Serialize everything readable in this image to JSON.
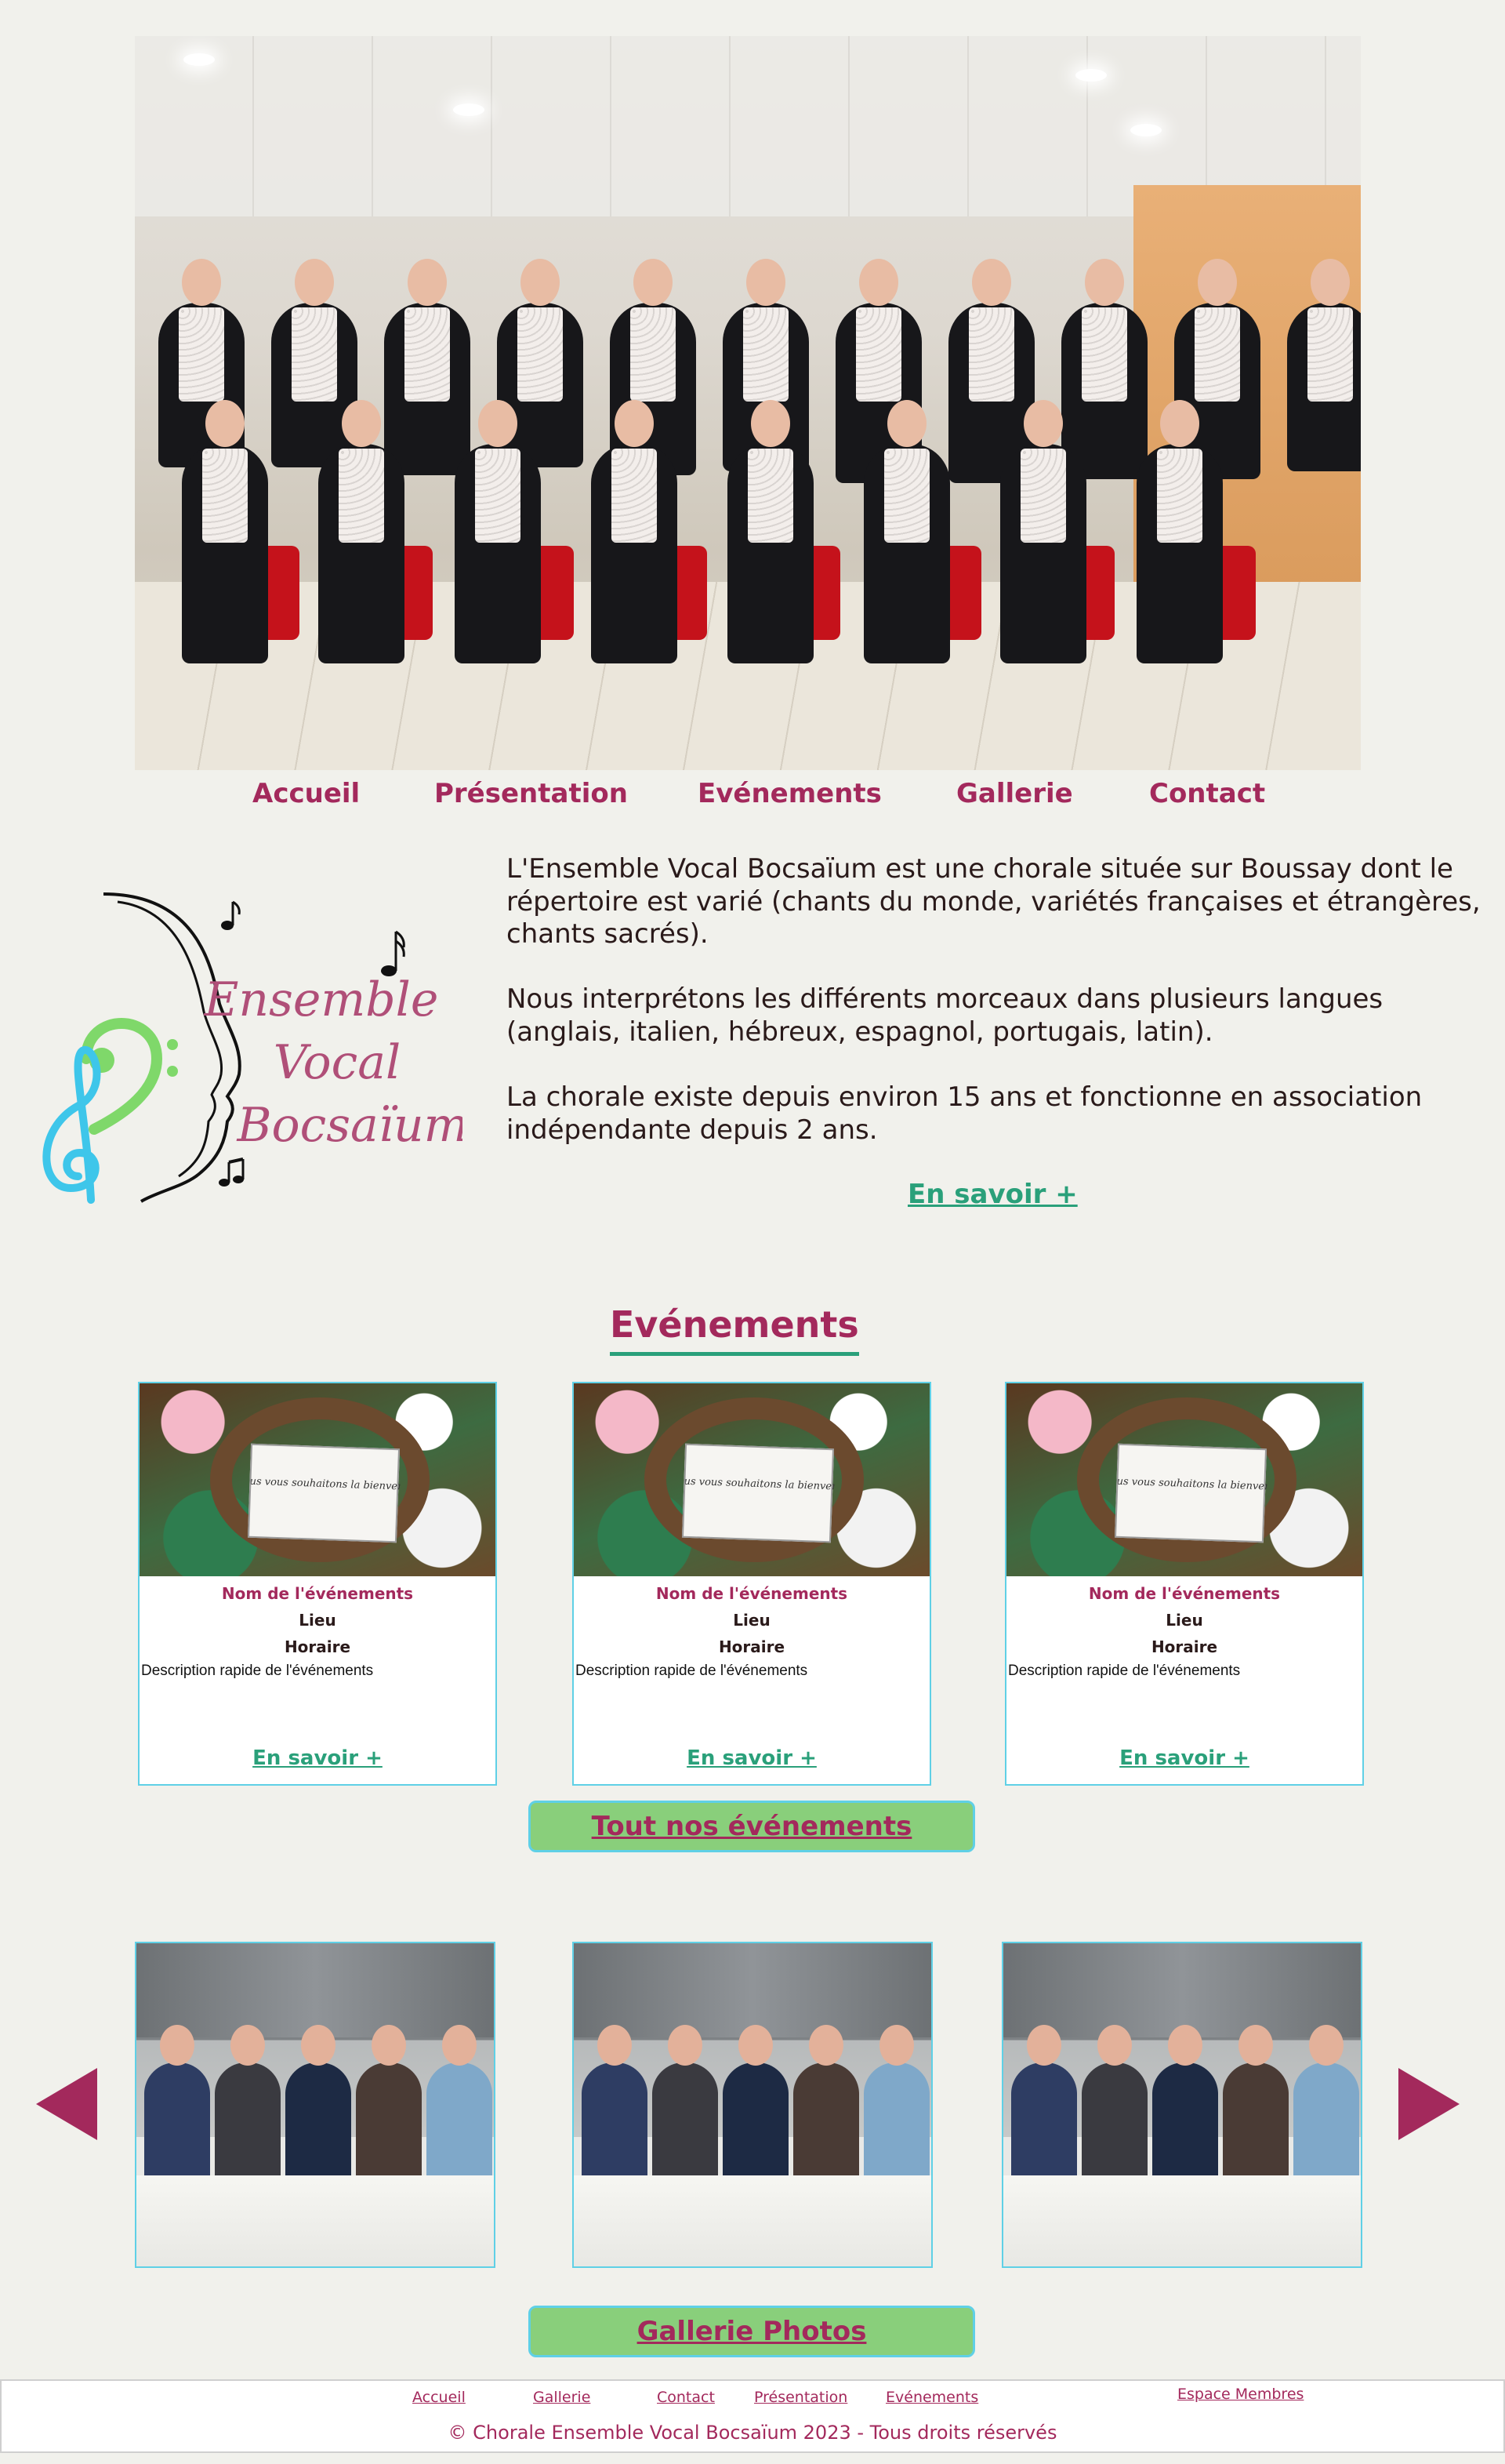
{
  "nav": {
    "items": [
      "Accueil",
      "Présentation",
      "Evénements",
      "Gallerie",
      "Contact"
    ]
  },
  "logo": {
    "line1": "Ensemble",
    "line2": "Vocal",
    "line3": "Bocsaïum"
  },
  "intro": {
    "paragraphs": [
      "L'Ensemble Vocal Bocsaïum est une chorale située sur Boussay dont le répertoire est varié (chants du monde, variétés françaises et étrangères, chants sacrés).",
      "Nous interprétons les différents morceaux dans plusieurs langues (anglais, italien, hébreux, espagnol, portugais, latin).",
      "La chorale existe depuis environ 15 ans et fonctionne en association indépendante depuis 2 ans."
    ],
    "more": "En savoir +"
  },
  "events": {
    "title": "Evénements",
    "cards": [
      {
        "image_text": "Nous vous souhaitons la bienvenue",
        "name": "Nom de l'événements",
        "place": "Lieu",
        "time": "Horaire",
        "description": "Description rapide de l'événements",
        "more": "En savoir +"
      },
      {
        "image_text": "Nous vous souhaitons la bienvenue",
        "name": "Nom de l'événements",
        "place": "Lieu",
        "time": "Horaire",
        "description": "Description rapide de l'événements",
        "more": "En savoir +"
      },
      {
        "image_text": "Nous vous souhaitons la bienvenue",
        "name": "Nom de l'événements",
        "place": "Lieu",
        "time": "Horaire",
        "description": "Description rapide de l'événements",
        "more": "En savoir +"
      }
    ],
    "all_button": "Tout nos événements"
  },
  "gallery": {
    "button": "Gallerie Photos",
    "prev_icon": "triangle-left-icon",
    "next_icon": "triangle-right-icon"
  },
  "footer": {
    "links": [
      "Accueil",
      "Gallerie",
      "Contact",
      "Présentation",
      "Evénements"
    ],
    "members": "Espace Membres",
    "copyright": "© Chorale Ensemble Vocal Bocsaïum 2023 - Tous droits réservés"
  },
  "colors": {
    "accent": "#a3295c",
    "green": "#2aa07a",
    "button_green": "#89cf7b",
    "border_cyan": "#5fd0e6",
    "background": "#f1f1ec"
  }
}
